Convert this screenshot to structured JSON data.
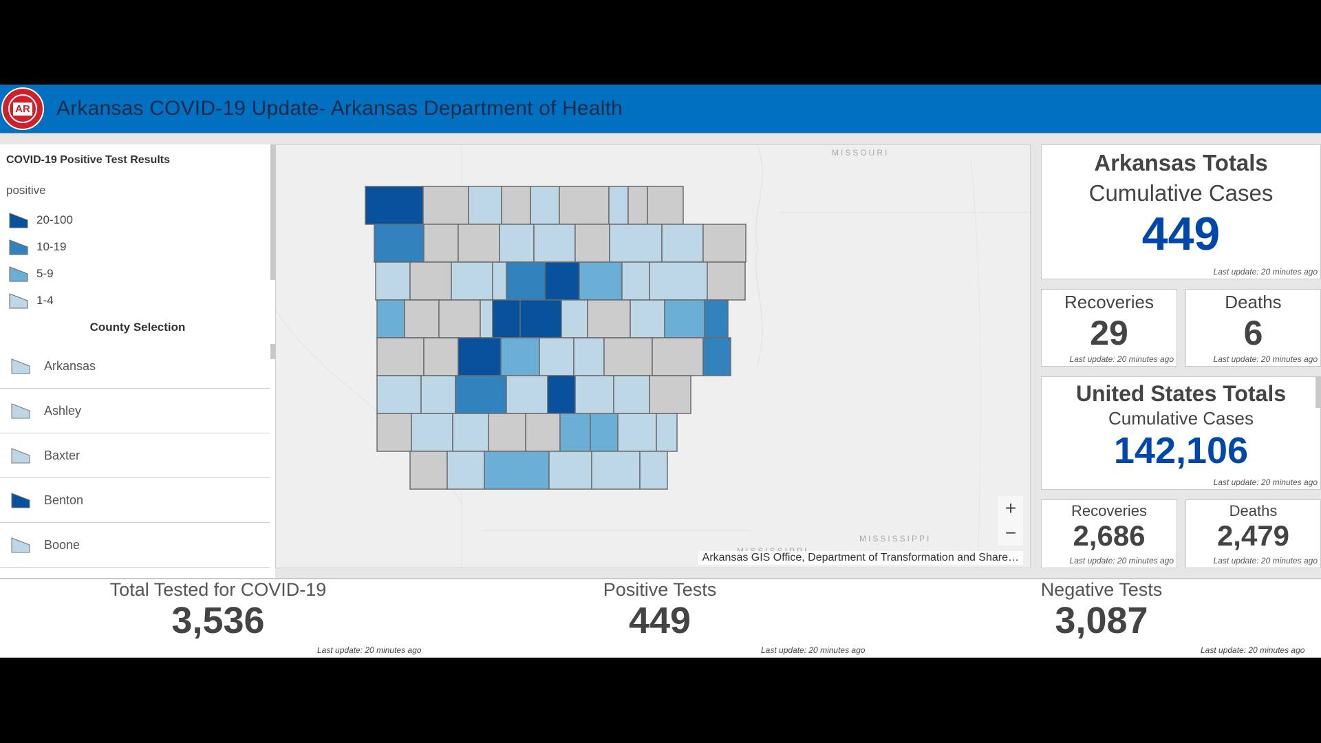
{
  "header": {
    "logo_text": "AR",
    "title": "Arkansas COVID-19 Update- Arkansas Department of Health"
  },
  "legend": {
    "title": "COVID-19 Positive Test Results",
    "field": "positive",
    "classes": [
      {
        "label": "20-100",
        "color": "#08519c"
      },
      {
        "label": "10-19",
        "color": "#3182bd"
      },
      {
        "label": "5-9",
        "color": "#6baed6"
      },
      {
        "label": "1-4",
        "color": "#bdd7e7"
      }
    ]
  },
  "county_selection": {
    "title": "County Selection",
    "items": [
      {
        "name": "Arkansas",
        "color": "#bdd7e7"
      },
      {
        "name": "Ashley",
        "color": "#bdd7e7"
      },
      {
        "name": "Baxter",
        "color": "#bdd7e7"
      },
      {
        "name": "Benton",
        "color": "#08519c"
      },
      {
        "name": "Boone",
        "color": "#bdd7e7"
      }
    ]
  },
  "map": {
    "labels": {
      "missouri": "MISSOURI",
      "mississippi_state": "MISSISSIPPI",
      "mississippi_river": "MISSISSIPPI"
    },
    "zoom_in": "+",
    "zoom_out": "−",
    "attribution": "Arkansas GIS Office, Department of Transformation and Share…",
    "no_data_color": "#cccccc"
  },
  "arkansas_totals": {
    "title": "Arkansas Totals",
    "subtitle": "Cumulative Cases",
    "cases": "449",
    "updated": "Last update: 20 minutes ago",
    "recoveries_label": "Recoveries",
    "recoveries": "29",
    "recoveries_updated": "Last update: 20 minutes ago",
    "deaths_label": "Deaths",
    "deaths": "6",
    "deaths_updated": "Last update: 20 minutes ago"
  },
  "us_totals": {
    "title": "United States Totals",
    "subtitle": "Cumulative Cases",
    "cases": "142,106",
    "updated": "Last update: 20 minutes ago",
    "recoveries_label": "Recoveries",
    "recoveries": "2,686",
    "recoveries_updated": "Last update: 20 minutes ago",
    "deaths_label": "Deaths",
    "deaths": "2,479",
    "deaths_updated": "Last update: 20 minutes ago"
  },
  "tests": {
    "total_label": "Total Tested for COVID-19",
    "total": "3,536",
    "total_updated": "Last update: 20 minutes ago",
    "positive_label": "Positive Tests",
    "positive": "449",
    "positive_updated": "Last update: 20 minutes ago",
    "negative_label": "Negative Tests",
    "negative": "3,087",
    "negative_updated": "Last update: 20 minutes ago"
  }
}
